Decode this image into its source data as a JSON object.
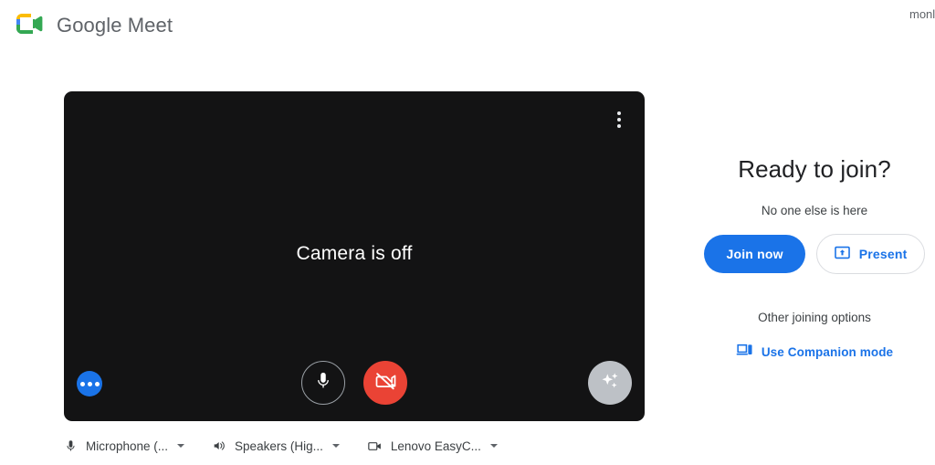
{
  "header": {
    "brand_title": "Google Meet",
    "logo_icon": "google-meet-logo-icon",
    "account_text": "monl"
  },
  "preview": {
    "camera_off_text": "Camera is off",
    "more_options_icon": "more-vertical-icon",
    "mic_icon": "microphone-icon",
    "camera_icon": "camera-off-icon",
    "effects_icon": "sparkle-effects-icon",
    "options_icon": "more-horizontal-icon",
    "background_color": "#131314",
    "camera_off_button_color": "#ea4335",
    "options_button_color": "#1a73e8",
    "effects_button_color": "#bdc1c6"
  },
  "devices": [
    {
      "label": "Microphone (...",
      "icon": "microphone-icon",
      "name": "microphone"
    },
    {
      "label": "Speakers (Hig...",
      "icon": "speaker-icon",
      "name": "speakers"
    },
    {
      "label": "Lenovo EasyC...",
      "icon": "camera-icon",
      "name": "camera"
    }
  ],
  "join_panel": {
    "heading": "Ready to join?",
    "subtitle": "No one else is here",
    "join_now_label": "Join now",
    "present_label": "Present",
    "present_icon": "present-screen-icon",
    "other_options_label": "Other joining options",
    "companion_mode_label": "Use Companion mode",
    "companion_mode_icon": "companion-device-icon",
    "accent_color": "#1a73e8"
  }
}
